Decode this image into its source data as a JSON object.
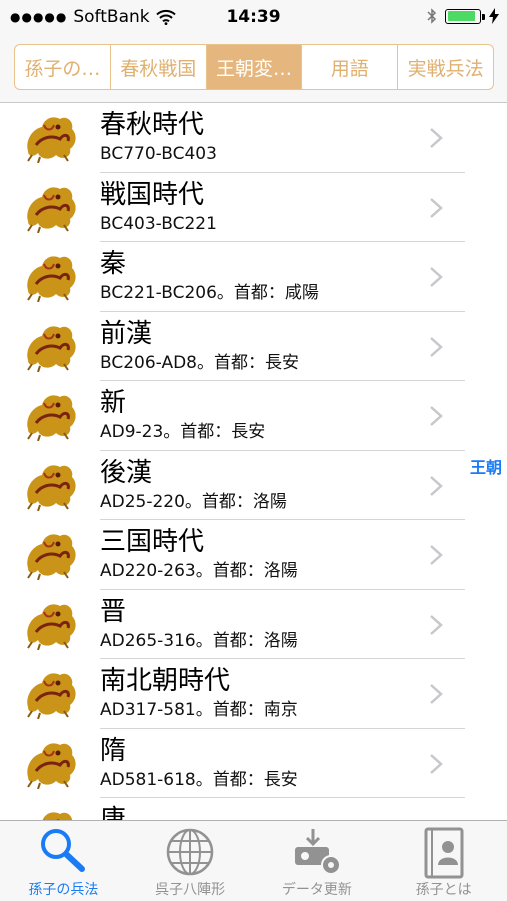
{
  "status": {
    "carrier": "SoftBank",
    "time": "14:39",
    "battery_level": 0.9
  },
  "segments": [
    {
      "label": "孫子の…",
      "active": false
    },
    {
      "label": "春秋戦国",
      "active": false
    },
    {
      "label": "王朝変…",
      "active": true
    },
    {
      "label": "用語",
      "active": false
    },
    {
      "label": "実戦兵法",
      "active": false
    }
  ],
  "rows": [
    {
      "title": "春秋時代",
      "subtitle": "BC770-BC403"
    },
    {
      "title": "戦国時代",
      "subtitle": "BC403-BC221"
    },
    {
      "title": "秦",
      "subtitle": "BC221-BC206。首都：咸陽"
    },
    {
      "title": "前漢",
      "subtitle": "BC206-AD8。首都：長安"
    },
    {
      "title": "新",
      "subtitle": "AD9-23。首都：長安"
    },
    {
      "title": "後漢",
      "subtitle": "AD25-220。首都：洛陽"
    },
    {
      "title": "三国時代",
      "subtitle": "AD220-263。首都：洛陽"
    },
    {
      "title": "晋",
      "subtitle": "AD265-316。首都：洛陽"
    },
    {
      "title": "南北朝時代",
      "subtitle": "AD317-581。首都：南京"
    },
    {
      "title": "隋",
      "subtitle": "AD581-618。首都：長安"
    },
    {
      "title": "唐",
      "subtitle": ""
    }
  ],
  "section_index": {
    "label": "王朝"
  },
  "tabs": [
    {
      "label": "孫子の兵法",
      "icon": "search-icon",
      "active": true
    },
    {
      "label": "呉子八陣形",
      "icon": "globe-icon",
      "active": false
    },
    {
      "label": "データ更新",
      "icon": "download-icon",
      "active": false
    },
    {
      "label": "孫子とは",
      "icon": "profile-book-icon",
      "active": false
    }
  ],
  "colors": {
    "accent": "#1a7cf5",
    "segment_accent": "#e5b77e",
    "battery": "#4cd964"
  }
}
